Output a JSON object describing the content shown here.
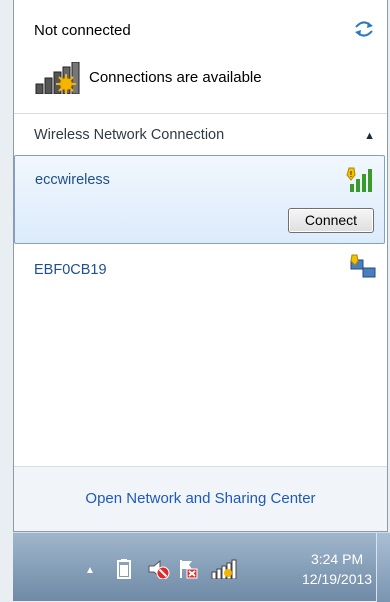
{
  "header": {
    "status": "Not connected",
    "availability": "Connections are available"
  },
  "section": {
    "title": "Wireless Network Connection"
  },
  "networks": [
    {
      "name": "eccwireless",
      "connect_label": "Connect",
      "selected": true
    },
    {
      "name": "EBF0CB19",
      "selected": false
    }
  ],
  "footer": {
    "link": "Open Network and Sharing Center"
  },
  "taskbar": {
    "time": "3:24 PM",
    "date": "12/19/2013"
  },
  "colors": {
    "link": "#1e5ab6",
    "network_name": "#1e4f8f",
    "selection_border": "#7da2ce"
  }
}
